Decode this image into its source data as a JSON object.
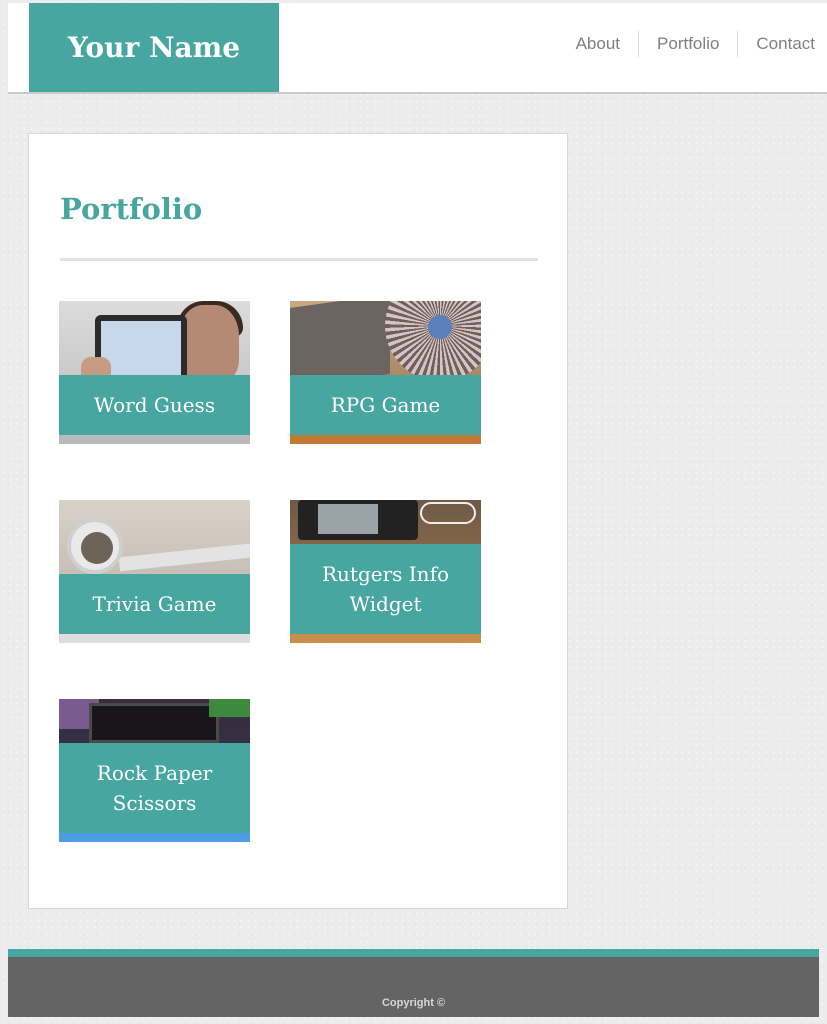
{
  "header": {
    "brand": "Your Name",
    "nav": [
      "About",
      "Portfolio",
      "Contact"
    ]
  },
  "main": {
    "title": "Portfolio",
    "projects": [
      {
        "name": "Word Guess"
      },
      {
        "name": "RPG Game"
      },
      {
        "name": "Trivia Game"
      },
      {
        "name": "Rutgers Info Widget"
      },
      {
        "name": "Rock Paper Scissors"
      }
    ]
  },
  "footer": {
    "copyright": "Copyright ©"
  },
  "colors": {
    "accent": "#48a6a0",
    "footer_bg": "#646464",
    "nav_text": "#7f7f7f"
  }
}
